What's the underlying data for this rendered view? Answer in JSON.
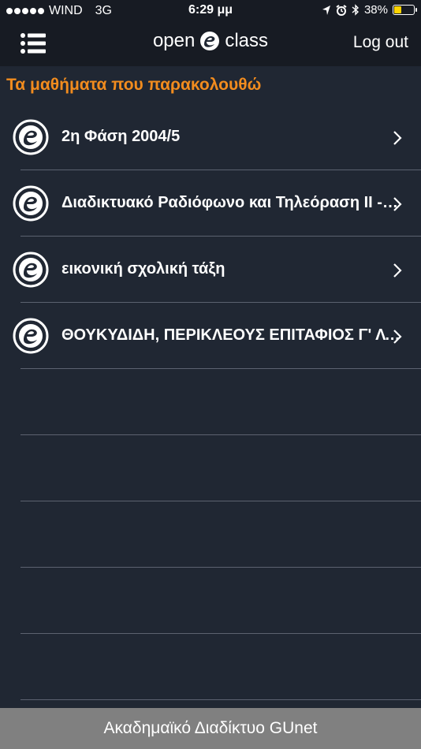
{
  "status_bar": {
    "carrier": "WIND",
    "network": "3G",
    "time": "6:29 μμ",
    "battery": "38%"
  },
  "nav": {
    "logo_left": "open",
    "logo_right": "class",
    "logout_label": "Log out"
  },
  "section_title": "Τα μαθήματα που παρακολουθώ",
  "courses": [
    {
      "title": "2η Φάση 2004/5"
    },
    {
      "title": "Διαδικτυακό Ραδιόφωνο και Τηλεόραση ΙΙ - Δ. Τ..."
    },
    {
      "title": "εικονική σχολική τάξη"
    },
    {
      "title": "ΘΟΥΚΥΔΙΔΗ, ΠΕΡΙΚΛΕΟΥΣ ΕΠΙΤΑΦΙΟΣ   Γ' ΛΥΚΕΙΟΥ"
    }
  ],
  "footer_text": "Ακαδημαϊκό Διαδίκτυο GUnet",
  "colors": {
    "background": "#202733",
    "accent": "#f28c1e",
    "footer": "#808080"
  }
}
